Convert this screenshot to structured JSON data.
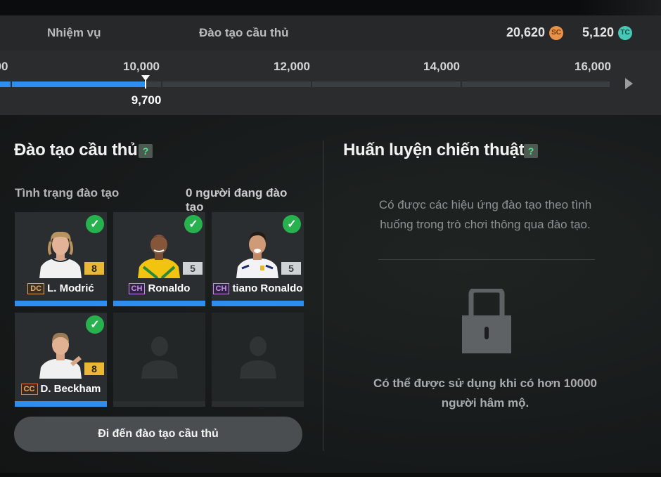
{
  "header": {
    "tab_missions": "Nhiệm vụ",
    "tab_training": "Đào tạo cầu thủ",
    "currency_sc": {
      "value": "20,620",
      "icon": "SC",
      "color": "#e8924a"
    },
    "currency_tc": {
      "value": "5,120",
      "icon": "TC",
      "color": "#49c7b6"
    }
  },
  "progress": {
    "ticks": [
      "00",
      "10,000",
      "12,000",
      "14,000",
      "16,000"
    ],
    "current_value": "9,700",
    "current": 9700,
    "fill_color": "#2e8ef0"
  },
  "training": {
    "title": "Đào tạo cầu thủ",
    "help": "?",
    "status_label": "Tình trạng đào tạo",
    "status_count": "0 người đang đào tạo",
    "players": [
      {
        "name": "L. Modrić",
        "position": "DC",
        "level": "8",
        "level_style": "gold",
        "checked": true,
        "kit": "white"
      },
      {
        "name": "Ronaldo",
        "position": "CH",
        "level": "5",
        "level_style": "silver",
        "checked": true,
        "kit": "yellow"
      },
      {
        "name": "tiano Ronaldo",
        "position": "CH",
        "level": "5",
        "level_style": "silver",
        "checked": true,
        "kit": "white"
      },
      {
        "name": "D. Beckham",
        "position": "CC",
        "level": "8",
        "level_style": "gold",
        "checked": true,
        "kit": "white"
      }
    ],
    "button_label": "Đi đến đào tạo cầu thủ"
  },
  "tactics": {
    "title": "Huấn luyện chiến thuật",
    "help": "?",
    "description": "Có được các hiệu ứng đào tạo theo tình huống trong trò chơi thông qua đào tạo.",
    "unlock_text": "Có thể được sử dụng khi có hơn 10000 người hâm mộ.",
    "icon": "lock-icon"
  }
}
